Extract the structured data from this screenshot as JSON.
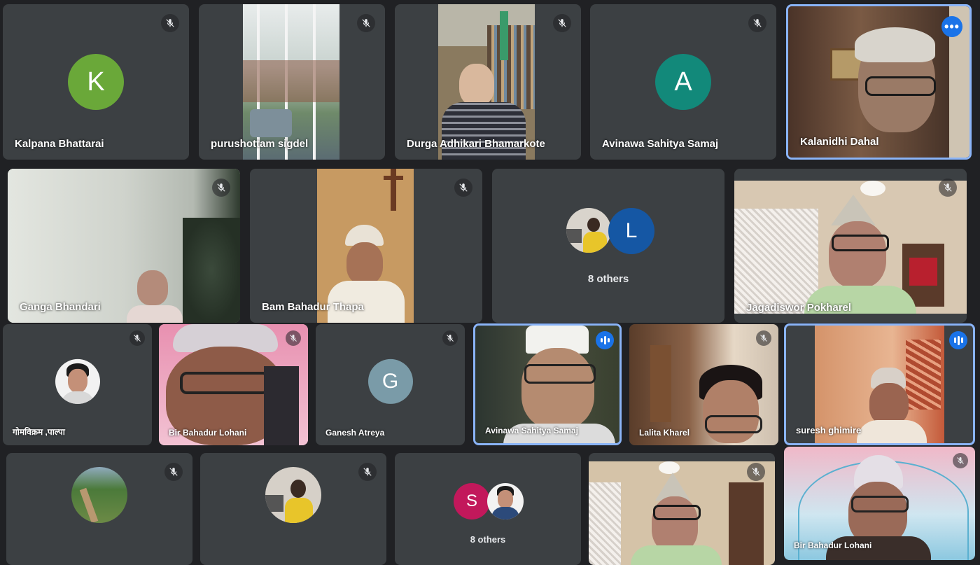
{
  "colors": {
    "background": "#202124",
    "tile": "#3c4043",
    "active_border": "#8ab4f8",
    "speaking": "#1a73e8"
  },
  "tiles": {
    "kalpana": {
      "name": "Kalpana Bhattarai",
      "initial": "K",
      "avatar_color": "#6aa839"
    },
    "purushottam": {
      "name": "purushottam sigdel"
    },
    "durga": {
      "name": "Durga Adhikari Bhamarkote"
    },
    "avinawa1": {
      "name": "Avinawa Sahitya Samaj",
      "initial": "A",
      "avatar_color": "#12897a"
    },
    "kalanidhi": {
      "name": "Kalanidhi Dahal",
      "menu_icon": "more-horizontal-icon"
    },
    "ganga": {
      "name": "Ganga Bhandari"
    },
    "bam": {
      "name": "Bam Bahadur Thapa"
    },
    "others1": {
      "label": "8 others",
      "initial": "L",
      "avatar_color": "#1557a4"
    },
    "jagadiswor": {
      "name": "Jagadiswor Pokharel"
    },
    "gomabikram": {
      "name": "गोमविक्रम ,पाल्पा"
    },
    "birlohani1": {
      "name": "Bir Bahadur Lohani"
    },
    "ganesh": {
      "name": "Ganesh Atreya",
      "initial": "G",
      "avatar_color": "#7a9ba8"
    },
    "avinawa2": {
      "name": "Avinawa Sahitya Samaj"
    },
    "lalita": {
      "name": "Lalita Kharel"
    },
    "suresh": {
      "name": "suresh ghimire"
    },
    "others2": {
      "label": "8 others",
      "initial": "S",
      "avatar_color": "#c2185b"
    },
    "birlohani2": {
      "name": "Bir Bahadur Lohani"
    }
  },
  "icons": {
    "muted": "mic-off-icon",
    "speaking": "audio-level-icon"
  }
}
